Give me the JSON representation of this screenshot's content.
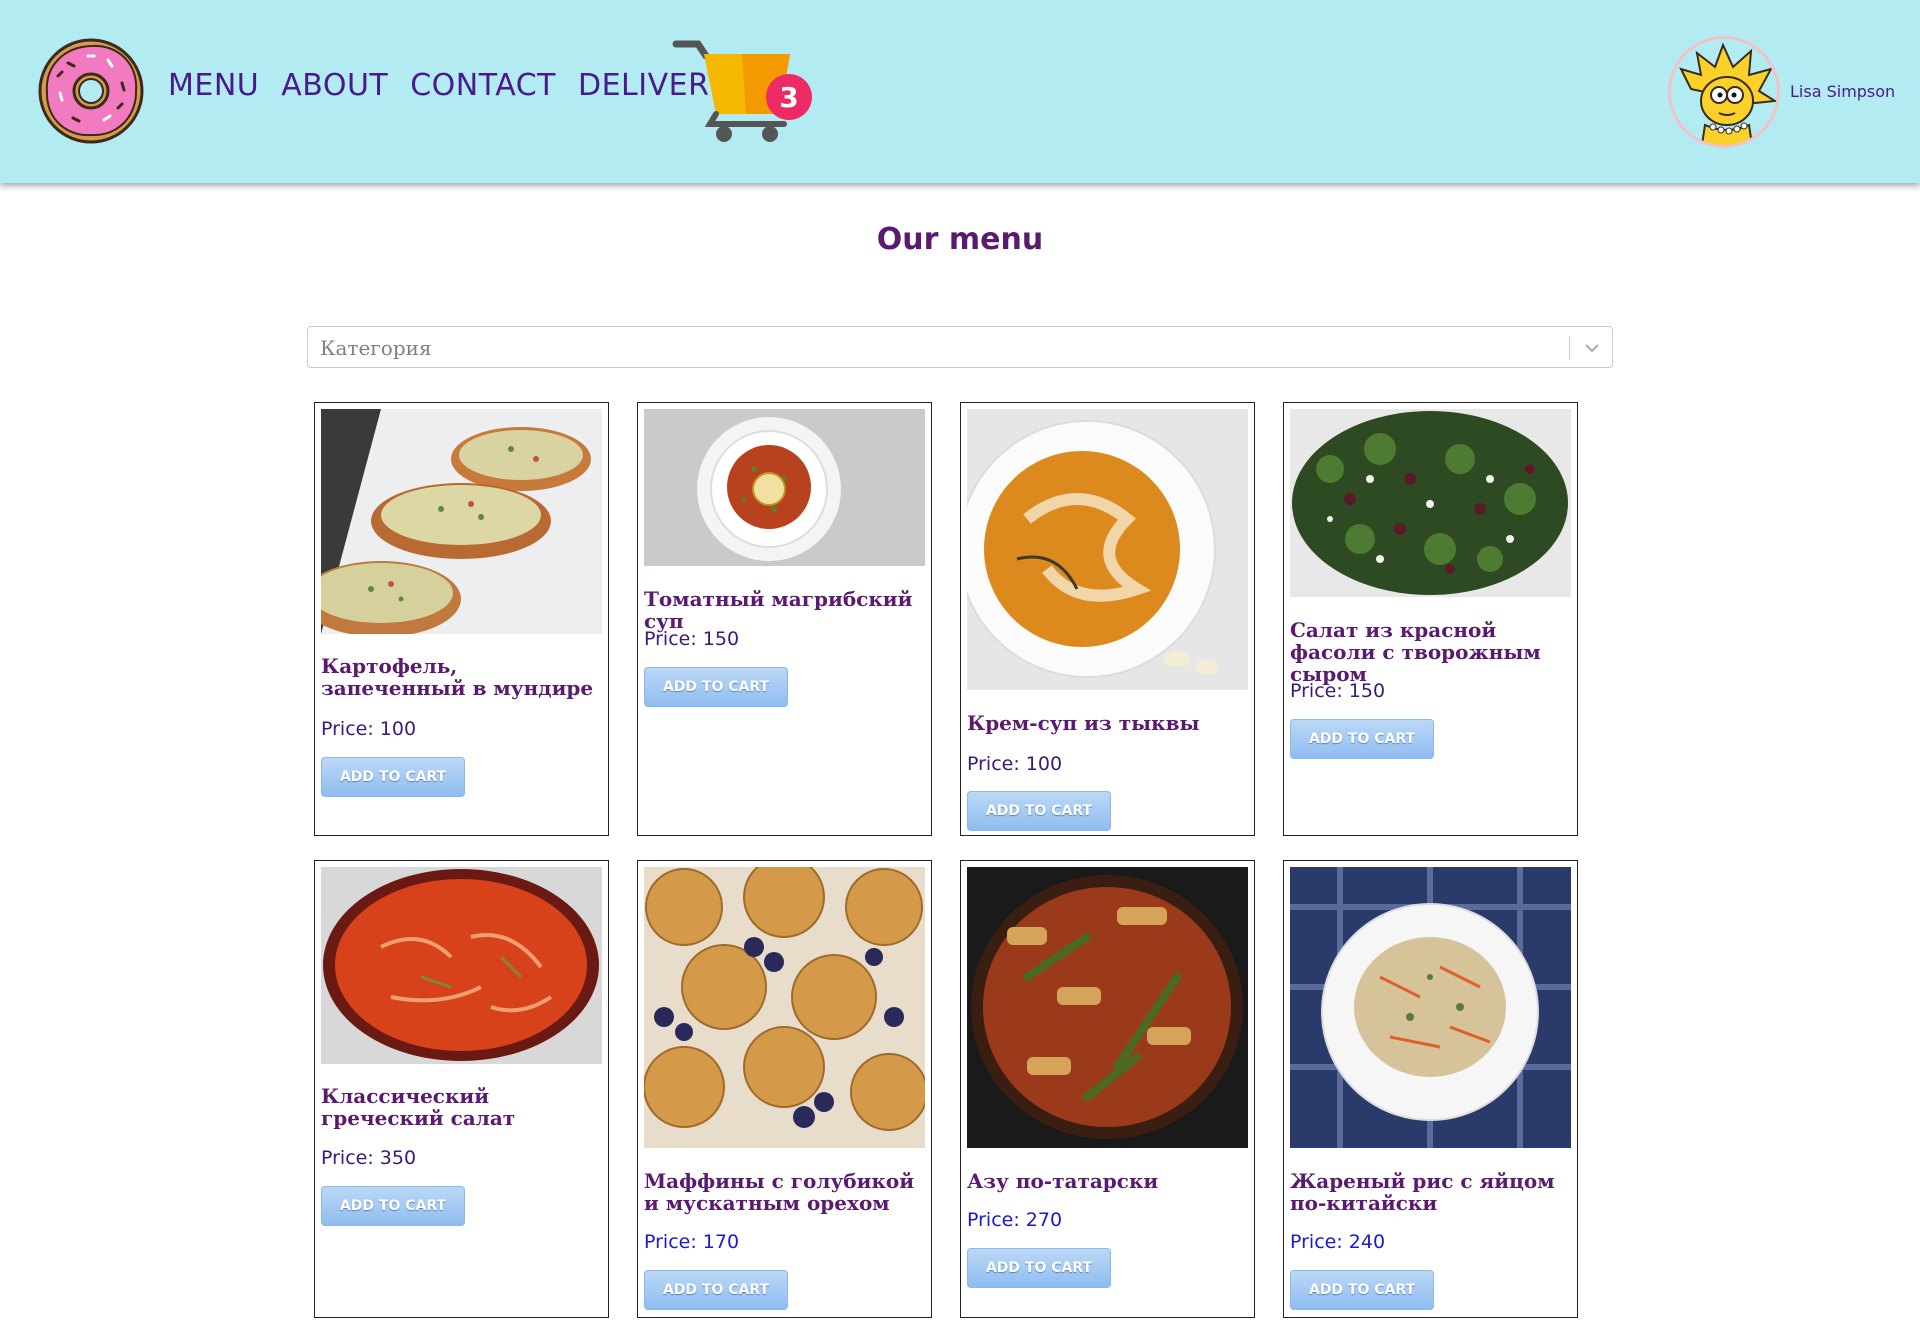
{
  "header": {
    "logo_icon": "donut-icon",
    "nav": [
      {
        "label": "MENU"
      },
      {
        "label": "ABOUT"
      },
      {
        "label": "CONTACT"
      },
      {
        "label": "DELIVERY"
      }
    ],
    "cart": {
      "icon": "cart-icon",
      "count": "3"
    },
    "user": {
      "name": "Lisa Simpson",
      "avatar_icon": "user-avatar-icon"
    }
  },
  "main": {
    "title": "Our menu",
    "category_select": {
      "placeholder": "Категория",
      "icon": "chevron-down-icon"
    },
    "products": [
      {
        "name": "Картофель, запеченный в мундире",
        "price": "Price: 100",
        "button": "ADD TO CART"
      },
      {
        "name": "Томатный магрибский суп",
        "price": "Price: 150",
        "button": "ADD TO CART"
      },
      {
        "name": "Крем-суп из тыквы",
        "price": "Price: 100",
        "button": "ADD TO CART"
      },
      {
        "name": "Салат из красной фасоли с творожным сыром",
        "price": "Price: 150",
        "button": "ADD TO CART"
      },
      {
        "name": "Классический греческий салат",
        "price": "Price: 350",
        "button": "ADD TO CART"
      },
      {
        "name": "Маффины с голубикой и мускатным орехом",
        "price": "Price: 170",
        "button": "ADD TO CART"
      },
      {
        "name": "Азу по-татарски",
        "price": "Price: 270",
        "button": "ADD TO CART"
      },
      {
        "name": "Жареный рис с яйцом по-китайски",
        "price": "Price: 240",
        "button": "ADD TO CART"
      }
    ]
  },
  "colors": {
    "header_bg": "#b3ebf3",
    "nav_text": "#4a1a8c",
    "title_text": "#5a1a70",
    "badge": "#ee2a64",
    "button": "#8fbdf0"
  }
}
